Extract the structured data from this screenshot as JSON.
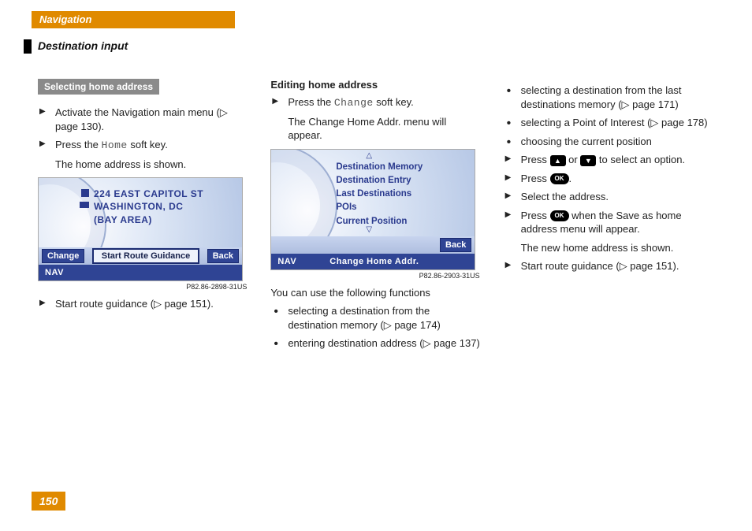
{
  "header": {
    "tab": "Navigation",
    "section": "Destination input"
  },
  "col1": {
    "subhead": "Selecting home address",
    "steps": [
      {
        "text": "Activate the Navigation main menu ",
        "ref": "(▷ page 130)."
      },
      {
        "pre": "Press the ",
        "mono": "Home",
        "post": " soft key."
      }
    ],
    "note": "The home address is shown.",
    "scr": {
      "addr1": "224 EAST CAPITOL ST",
      "addr2": "WASHINGTON, DC",
      "addr3": "(BAY AREA)",
      "change": "Change",
      "route": "Start Route Guidance",
      "back": "Back",
      "nav": "NAV"
    },
    "imgcode": "P82.86-2898-31US",
    "after": {
      "text": "Start route guidance ",
      "ref": "(▷ page 151)."
    }
  },
  "col2": {
    "heading": "Editing home address",
    "step": {
      "pre": "Press the ",
      "mono": "Change",
      "post": " soft key."
    },
    "note": "The Change Home Addr. menu will appear.",
    "scr": {
      "menu": [
        "Destination Memory",
        "Destination Entry",
        "Last Destinations",
        "POIs",
        "Current Position"
      ],
      "back": "Back",
      "nav": "NAV",
      "title": "Change Home Addr."
    },
    "imgcode": "P82.86-2903-31US",
    "lead": "You can use the following functions",
    "bullets": [
      {
        "text": "selecting a destination from the destination memory ",
        "ref": "(▷ page 174)"
      },
      {
        "text": "entering destination address ",
        "ref": "(▷ page 137)"
      }
    ]
  },
  "col3": {
    "bullets": [
      {
        "text": "selecting a destination from the last destinations memory ",
        "ref": "(▷ page 171)"
      },
      {
        "text": "selecting a Point of Interest ",
        "ref": "(▷ page 178)"
      },
      {
        "text": "choosing the current position",
        "ref": ""
      }
    ],
    "steps": [
      {
        "pre": "Press ",
        "key1": "▲",
        "mid": " or ",
        "key2": "▼",
        "post": " to select an option."
      },
      {
        "pre": "Press ",
        "key1": "OK",
        "post": "."
      },
      {
        "text": "Select the address."
      },
      {
        "pre": "Press ",
        "key1": "OK",
        "post": " when the Save as home address menu will appear."
      }
    ],
    "note": "The new home address is shown.",
    "after": {
      "text": "Start route guidance ",
      "ref": "(▷ page 151)."
    }
  },
  "page": "150"
}
